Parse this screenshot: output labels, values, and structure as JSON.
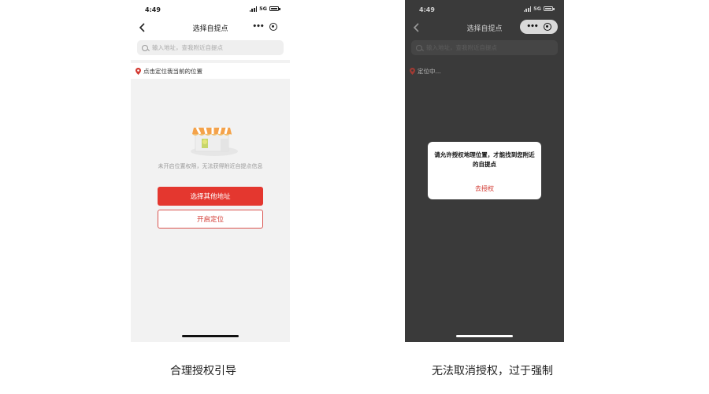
{
  "left_phone": {
    "status_time": "4:49",
    "network": "5G",
    "nav_title": "选择自提点",
    "search_placeholder": "输入地址，查我附近自提点",
    "location_prompt": "点击定位我当前的位置",
    "empty_message": "未开启位置权限，无法获得附近自提点信息",
    "primary_button": "选择其他地址",
    "secondary_button": "开启定位",
    "caption": "合理授权引导"
  },
  "right_phone": {
    "status_time": "4:49",
    "network": "5G",
    "nav_title": "选择自提点",
    "search_placeholder": "输入地址，查我附近自提点",
    "locating_text": "定位中...",
    "dialog_message": "请允许授权地理位置，才能找到您附近的自提点",
    "dialog_button": "去授权",
    "caption": "无法取消授权，过于强制"
  },
  "colors": {
    "accent_red": "#e4372f",
    "overlay_dark": "#3a3a3a"
  }
}
